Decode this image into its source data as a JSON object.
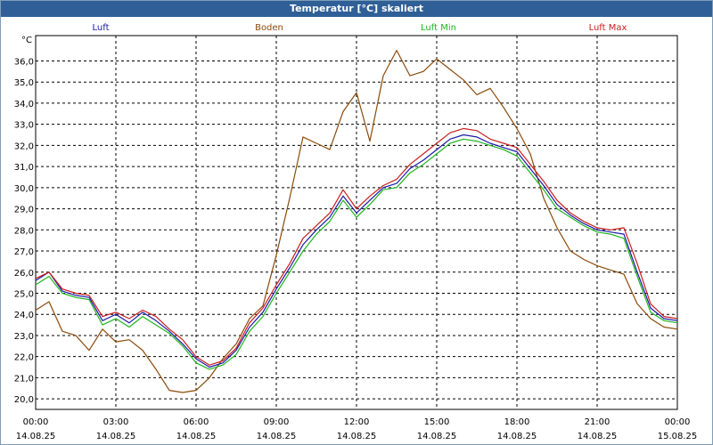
{
  "window": {
    "title": "Temperatur [°C] skaliert"
  },
  "chart_data": {
    "type": "line",
    "title": "Temperatur [°C] skaliert",
    "ylabel": "°C",
    "xlabel": "",
    "ylim": [
      19.5,
      37.2
    ],
    "xlim": [
      0,
      24
    ],
    "y_ticks": [
      "20,0",
      "21,0",
      "22,0",
      "23,0",
      "24,0",
      "25,0",
      "26,0",
      "27,0",
      "28,0",
      "29,0",
      "30,0",
      "31,0",
      "32,0",
      "33,0",
      "34,0",
      "35,0",
      "36,0"
    ],
    "x_ticks": [
      {
        "time": "00:00",
        "date": "14.08.25"
      },
      {
        "time": "03:00",
        "date": "14.08.25"
      },
      {
        "time": "06:00",
        "date": "14.08.25"
      },
      {
        "time": "09:00",
        "date": "14.08.25"
      },
      {
        "time": "12:00",
        "date": "14.08.25"
      },
      {
        "time": "15:00",
        "date": "14.08.25"
      },
      {
        "time": "18:00",
        "date": "14.08.25"
      },
      {
        "time": "21:00",
        "date": "14.08.25"
      },
      {
        "time": "00:00",
        "date": "15.08.25"
      }
    ],
    "grid": true,
    "legend_position": "top",
    "series": [
      {
        "name": "Luft",
        "color": "#1a1aa8",
        "x": [
          0,
          0.5,
          1,
          1.5,
          2,
          2.5,
          3,
          3.5,
          4,
          4.5,
          5,
          5.5,
          6,
          6.5,
          7,
          7.5,
          8,
          8.5,
          9,
          9.5,
          10,
          10.5,
          11,
          11.5,
          12,
          12.5,
          13,
          13.5,
          14,
          14.5,
          15,
          15.5,
          16,
          16.5,
          17,
          17.5,
          18,
          18.5,
          19,
          19.5,
          20,
          20.5,
          21,
          21.5,
          22,
          22.5,
          23,
          23.5,
          24
        ],
        "y": [
          25.6,
          26.0,
          25.1,
          24.9,
          24.8,
          23.7,
          24.0,
          23.6,
          24.1,
          23.7,
          23.2,
          22.6,
          21.9,
          21.5,
          21.7,
          22.3,
          23.4,
          24.1,
          25.2,
          26.2,
          27.3,
          28.0,
          28.6,
          29.6,
          28.8,
          29.4,
          30.0,
          30.2,
          30.9,
          31.3,
          31.8,
          32.3,
          32.5,
          32.4,
          32.1,
          31.9,
          31.7,
          30.9,
          30.1,
          29.2,
          28.7,
          28.3,
          28.0,
          27.9,
          27.8,
          26.0,
          24.3,
          23.8,
          23.7
        ]
      },
      {
        "name": "Boden",
        "color": "#8b4a0a",
        "x": [
          0,
          0.5,
          1,
          1.5,
          2,
          2.5,
          3,
          3.5,
          4,
          4.5,
          5,
          5.5,
          6,
          6.5,
          7,
          7.5,
          8,
          8.5,
          9,
          9.5,
          10,
          10.5,
          11,
          11.5,
          12,
          12.5,
          13,
          13.5,
          14,
          14.5,
          15,
          15.5,
          16,
          16.5,
          17,
          17.5,
          18,
          18.5,
          19,
          19.5,
          20,
          20.5,
          21,
          21.5,
          22,
          22.5,
          23,
          23.5,
          24
        ],
        "y": [
          24.2,
          24.6,
          23.2,
          23.0,
          22.3,
          23.3,
          22.7,
          22.8,
          22.3,
          21.4,
          20.4,
          20.3,
          20.4,
          21.0,
          21.9,
          22.6,
          23.8,
          24.4,
          26.8,
          29.5,
          32.4,
          32.1,
          31.8,
          33.6,
          34.5,
          32.2,
          35.3,
          36.5,
          35.3,
          35.5,
          36.1,
          35.6,
          35.1,
          34.4,
          34.7,
          33.8,
          32.8,
          31.6,
          29.5,
          28.1,
          27.0,
          26.6,
          26.3,
          26.1,
          25.9,
          24.5,
          23.8,
          23.4,
          23.3
        ]
      },
      {
        "name": "Luft Min",
        "color": "#1fb51f",
        "x": [
          0,
          0.5,
          1,
          1.5,
          2,
          2.5,
          3,
          3.5,
          4,
          4.5,
          5,
          5.5,
          6,
          6.5,
          7,
          7.5,
          8,
          8.5,
          9,
          9.5,
          10,
          10.5,
          11,
          11.5,
          12,
          12.5,
          13,
          13.5,
          14,
          14.5,
          15,
          15.5,
          16,
          16.5,
          17,
          17.5,
          18,
          18.5,
          19,
          19.5,
          20,
          20.5,
          21,
          21.5,
          22,
          22.5,
          23,
          23.5,
          24
        ],
        "y": [
          25.4,
          25.8,
          25.0,
          24.8,
          24.7,
          23.5,
          23.8,
          23.4,
          23.9,
          23.5,
          23.1,
          22.5,
          21.7,
          21.4,
          21.6,
          22.1,
          23.2,
          23.9,
          25.0,
          26.0,
          27.0,
          27.8,
          28.4,
          29.4,
          28.6,
          29.2,
          29.9,
          30.0,
          30.7,
          31.1,
          31.6,
          32.1,
          32.3,
          32.2,
          32.0,
          31.8,
          31.5,
          30.7,
          29.9,
          29.0,
          28.6,
          28.2,
          27.9,
          27.8,
          27.6,
          25.8,
          24.1,
          23.7,
          23.6
        ]
      },
      {
        "name": "Luft Max",
        "color": "#c81e1e",
        "x": [
          0,
          0.5,
          1,
          1.5,
          2,
          2.5,
          3,
          3.5,
          4,
          4.5,
          5,
          5.5,
          6,
          6.5,
          7,
          7.5,
          8,
          8.5,
          9,
          9.5,
          10,
          10.5,
          11,
          11.5,
          12,
          12.5,
          13,
          13.5,
          14,
          14.5,
          15,
          15.5,
          16,
          16.5,
          17,
          17.5,
          18,
          18.5,
          19,
          19.5,
          20,
          20.5,
          21,
          21.5,
          22,
          22.5,
          23,
          23.5,
          24
        ],
        "y": [
          25.7,
          26.0,
          25.2,
          25.0,
          24.9,
          23.9,
          24.1,
          23.8,
          24.2,
          23.9,
          23.3,
          22.8,
          22.0,
          21.6,
          21.8,
          22.4,
          23.6,
          24.3,
          25.4,
          26.4,
          27.6,
          28.2,
          28.8,
          29.9,
          29.0,
          29.6,
          30.1,
          30.4,
          31.1,
          31.6,
          32.1,
          32.6,
          32.8,
          32.7,
          32.3,
          32.1,
          31.9,
          31.1,
          30.3,
          29.4,
          28.8,
          28.4,
          28.1,
          28.0,
          28.1,
          26.4,
          24.5,
          23.9,
          23.8
        ]
      }
    ]
  }
}
